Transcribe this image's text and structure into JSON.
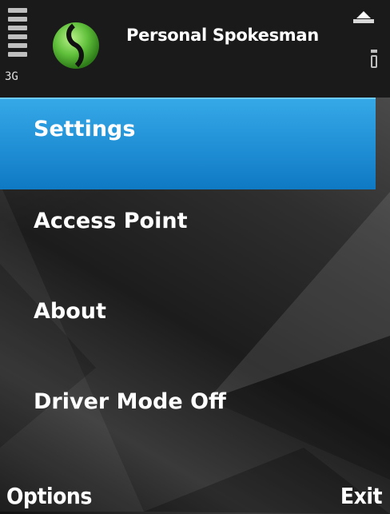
{
  "status": {
    "network": "3G"
  },
  "app": {
    "title": "Personal Spokesman",
    "logo_icon": "green-orb-logo-icon"
  },
  "menu": {
    "items": [
      {
        "label": "Settings",
        "selected": true
      },
      {
        "label": "Access Point",
        "selected": false
      },
      {
        "label": "About",
        "selected": false
      },
      {
        "label": "Driver Mode Off",
        "selected": false
      }
    ]
  },
  "softkeys": {
    "left": "Options",
    "right": "Exit"
  },
  "colors": {
    "highlight": "#1e90d8",
    "background": "#2a2a2a",
    "logo": "#5fbf3a"
  }
}
